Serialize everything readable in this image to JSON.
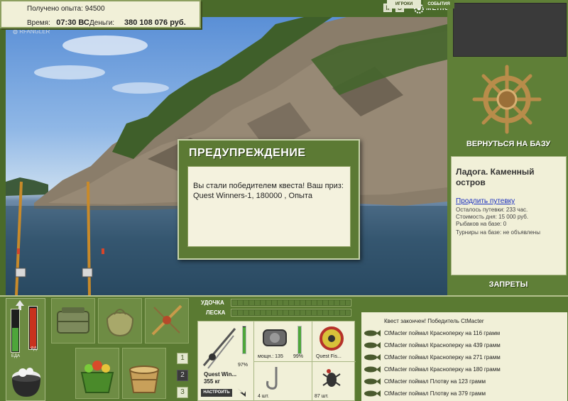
{
  "stats": {
    "xp_label": "Получено опыта: 94500",
    "time_label": "Время:",
    "time_value": "07:30 ВС",
    "money_label": "Деньги:",
    "money_value": "380 108 076 руб."
  },
  "header": {
    "pause_glyph": "II",
    "sound_glyph": "S",
    "menu_label": "МЕНЮ"
  },
  "sidebar": {
    "return_label": "ВЕРНУТЬСЯ НА БАЗУ",
    "base_title": "Ладога. Каменный остров",
    "extend_link": "Продлить путевку",
    "remaining": "Осталось путевки: 233 час.",
    "day_cost": "Стоимость дня: 15 000 руб.",
    "anglers": "Рыбаков на базе: 0",
    "tournaments": "Турниры на базе: не объявлены",
    "bans_label": "ЗАПРЕТЫ"
  },
  "dialog": {
    "title": "ПРЕДУПРЕЖДЕНИЕ",
    "message": "Вы стали победителем квеста! Ваш приз: Quest Winners-1, 180000 , Опыта"
  },
  "gauges": {
    "food_label": "ЕДА",
    "poison_label": "ЯД",
    "food_level": 0.55,
    "poison_level": 0.95
  },
  "inventory": {
    "pages": [
      "1",
      "2",
      "3"
    ],
    "active_page": 1
  },
  "tackle": {
    "rod_label": "УДОЧКА",
    "line_label": "ЛЕСКА",
    "rod_name": "Quest Win...",
    "rod_weight": "355 кг",
    "rod_durability": "97%",
    "rod_durability_level": 0.97,
    "reel_power": "мощн.: 135",
    "reel_durability": "99%",
    "reel_durability_level": 0.99,
    "line_name": "Quest Fis...",
    "hooks_count": "4 шт.",
    "bait_count": "87 шт.",
    "adjust_label": "НАСТРОИТЬ"
  },
  "chat": {
    "tab_players": "ИГРОКИ",
    "tab_events": "СОБЫТИЯ",
    "messages": [
      "Квест закончен! Победитель CtMacter",
      "CtMacter поймал Красноперку на 116 грамм",
      "CtMacter поймал Красноперку на 439 грамм",
      "CtMacter поймал Красноперку на 271 грамм",
      "CtMacter поймал Красноперку на 180 грамм",
      "CtMacter поймал Плотву на 123 грамм",
      "CtMacter поймал Плотву на 379 грамм"
    ]
  },
  "colors": {
    "panel_green": "#5a7a32",
    "panel_cream": "#f1f0d8",
    "link_blue": "#1a2fc0",
    "gauge_green": "#4ea63a",
    "gauge_red": "#c8321e"
  }
}
